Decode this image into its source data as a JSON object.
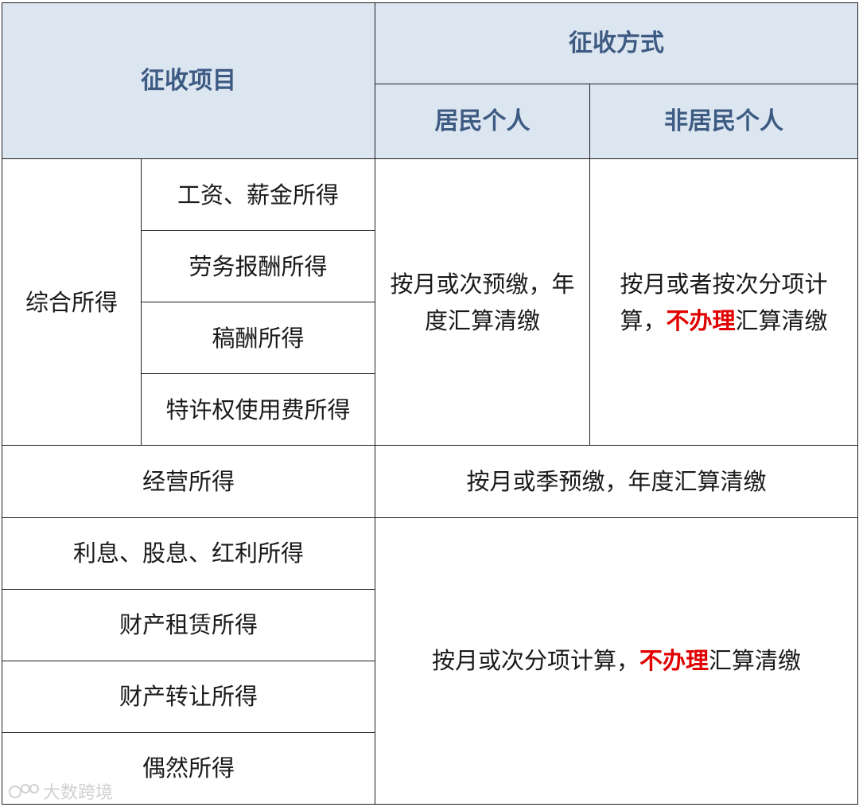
{
  "header": {
    "item_col": "征收项目",
    "method_col": "征收方式",
    "resident": "居民个人",
    "non_resident": "非居民个人"
  },
  "comprehensive": {
    "group": "综合所得",
    "items": [
      "工资、薪金所得",
      "劳务报酬所得",
      "稿酬所得",
      "特许权使用费所得"
    ],
    "resident_method": "按月或次预缴，年度汇算清缴",
    "non_resident_method": {
      "pre": "按月或者按次分项计算，",
      "highlight": "不办理",
      "post": "汇算清缴"
    }
  },
  "business": {
    "item": "经营所得",
    "method": "按月或季预缴，年度汇算清缴"
  },
  "others": {
    "items": [
      "利息、股息、红利所得",
      "财产租赁所得",
      "财产转让所得",
      "偶然所得"
    ],
    "method": {
      "pre": "按月或次分项计算，",
      "highlight": "不办理",
      "post": "汇算清缴"
    }
  },
  "watermark": "大数跨境",
  "colors": {
    "header_bg": "#dce6f1",
    "header_text": "#3d5a82",
    "highlight": "#e00000"
  }
}
